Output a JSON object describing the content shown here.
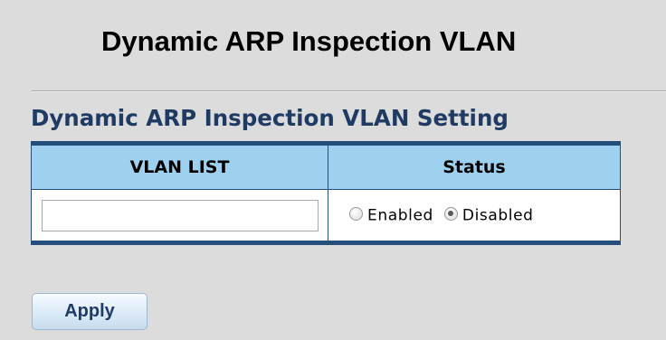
{
  "page": {
    "title": "Dynamic ARP Inspection VLAN"
  },
  "section": {
    "title": "Dynamic ARP Inspection VLAN Setting"
  },
  "table": {
    "columns": [
      "VLAN LIST",
      "Status"
    ],
    "row": {
      "vlan_list_value": "",
      "status_options": [
        {
          "label": "Enabled",
          "selected": false
        },
        {
          "label": "Disabled",
          "selected": true
        }
      ]
    }
  },
  "actions": {
    "apply_label": "Apply"
  },
  "colors": {
    "header_bg": "#9ed0ef",
    "table_border": "#244f7d",
    "section_title": "#1f3b64",
    "page_bg": "#dcdcdc"
  },
  "icons": {
    "radio_unselected": "radio-unselected-icon",
    "radio_selected": "radio-selected-icon"
  }
}
